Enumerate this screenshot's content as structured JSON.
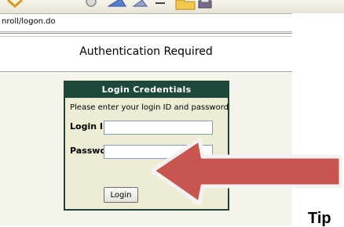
{
  "browser": {
    "url": "nroll/logon.do",
    "toolbar_icons": [
      "back-arrow-icon",
      "refresh-icon",
      "favorites-icon",
      "history-icon",
      "dash-icon",
      "folder-icon",
      "print-icon"
    ]
  },
  "page": {
    "title": "Authentication Required"
  },
  "login_panel": {
    "header": "Login Credentials",
    "instructions": "Please enter your login ID and password",
    "login_id_label": "Login ID",
    "login_id_value": "",
    "password_label": "Password",
    "password_value": "",
    "login_button": "Login"
  },
  "annotation": {
    "arrow_color": "#c95550",
    "tip_text": "Tip"
  }
}
